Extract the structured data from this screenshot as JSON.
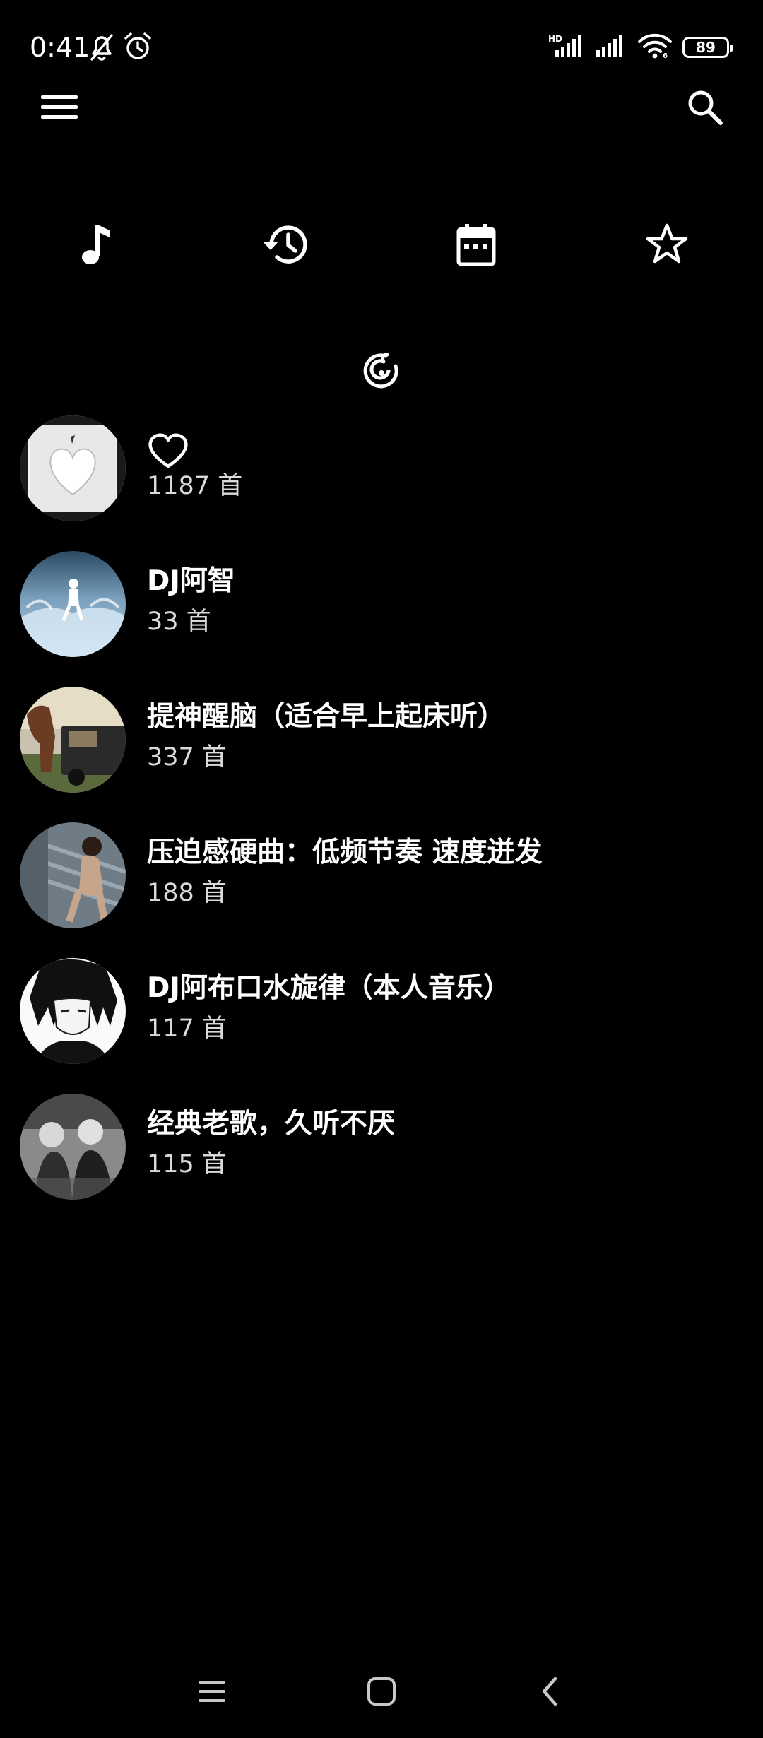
{
  "status_bar": {
    "time": "0:41",
    "battery": "89",
    "icons": [
      "bell-off-icon",
      "alarm-icon",
      "hd-signal-icon",
      "signal-icon",
      "wifi-icon",
      "battery-icon"
    ]
  },
  "app_bar": {
    "icons": [
      "menu-icon",
      "search-icon"
    ]
  },
  "quick_actions": {
    "icons": [
      "music-note-icon",
      "history-icon",
      "calendar-icon",
      "star-icon"
    ]
  },
  "logo": {
    "icon": "netease-music-logo-icon"
  },
  "playlists": [
    {
      "title": "",
      "title_icon": "heart-outline-icon",
      "count": "1187 首",
      "cover": "white-heart-cover"
    },
    {
      "title": "DJ阿智",
      "count": "33 首",
      "cover": "ice-splash-cover"
    },
    {
      "title": "提神醒脑（适合早上起床听）",
      "count": "337 首",
      "cover": "horse-car-cover"
    },
    {
      "title": "压迫感硬曲：低频节奏 速度迸发",
      "count": "188 首",
      "cover": "woman-stairs-cover"
    },
    {
      "title": "DJ阿布口水旋律（本人音乐）",
      "count": "117 首",
      "cover": "anime-portrait-cover"
    },
    {
      "title": "经典老歌，久听不厌",
      "count": "115 首",
      "cover": "bw-photo-cover"
    }
  ],
  "nav_bar": {
    "icons": [
      "recents-icon",
      "home-icon",
      "back-icon"
    ]
  },
  "colors": {
    "background": "#000000",
    "primary_text": "#ffffff",
    "secondary_text": "#d9d9d9"
  }
}
